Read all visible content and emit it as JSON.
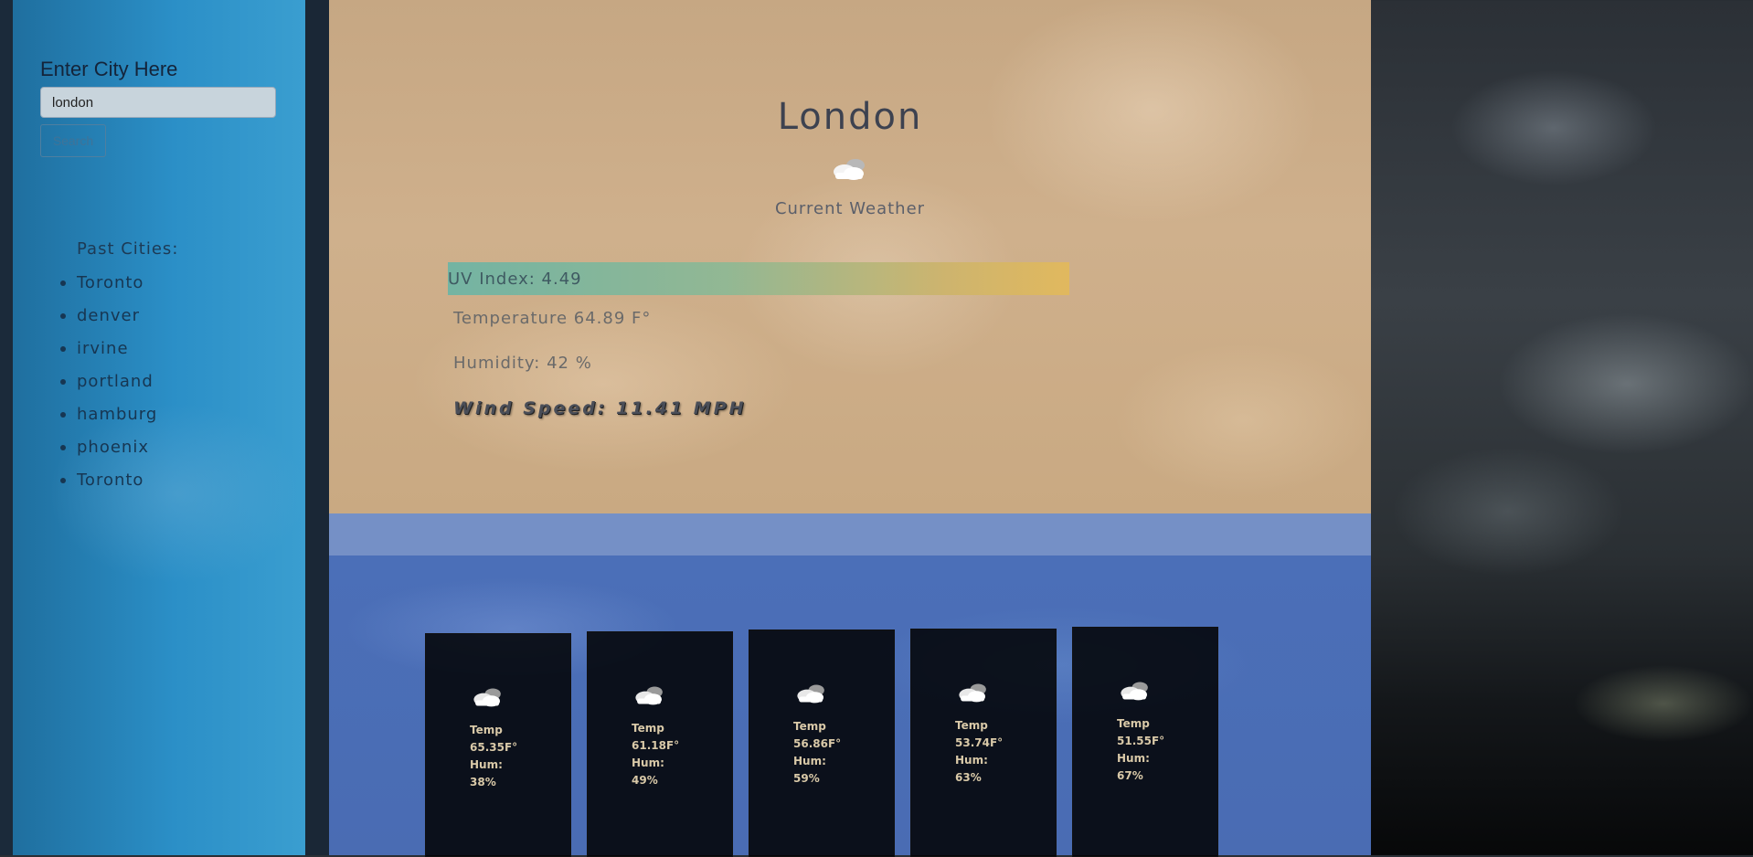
{
  "sidebar": {
    "label": "Enter City Here",
    "input_value": "london",
    "search_label": "Search",
    "past_title": "Past Cities:",
    "past_cities": [
      "Toronto",
      "denver",
      "irvine",
      "portland",
      "hamburg",
      "phoenix",
      "Toronto"
    ]
  },
  "current": {
    "city": "London",
    "icon": "cloudy-icon",
    "label": "Current Weather",
    "uv": "UV Index: 4.49",
    "temperature": "Temperature 64.89 F°",
    "humidity": "Humidity: 42 %",
    "wind": "Wind Speed: 11.41 MPH"
  },
  "forecast": [
    {
      "icon": "cloudy-icon",
      "temp_label": "Temp",
      "temp": "65.35F°",
      "hum_label": "Hum:",
      "hum": "38%"
    },
    {
      "icon": "cloudy-icon",
      "temp_label": "Temp",
      "temp": "61.18F°",
      "hum_label": "Hum:",
      "hum": "49%"
    },
    {
      "icon": "cloudy-icon",
      "temp_label": "Temp",
      "temp": "56.86F°",
      "hum_label": "Hum:",
      "hum": "59%"
    },
    {
      "icon": "cloudy-icon",
      "temp_label": "Temp",
      "temp": "53.74F°",
      "hum_label": "Hum:",
      "hum": "63%"
    },
    {
      "icon": "cloudy-icon",
      "temp_label": "Temp",
      "temp": "51.55F°",
      "hum_label": "Hum:",
      "hum": "67%"
    }
  ],
  "colors": {
    "sidebar": "#2b8fc7",
    "current_bg": "#c6a783",
    "forecast_bg": "#4b6fb8",
    "uv_start": "#6fb4a4",
    "uv_end": "#e2b95c"
  }
}
